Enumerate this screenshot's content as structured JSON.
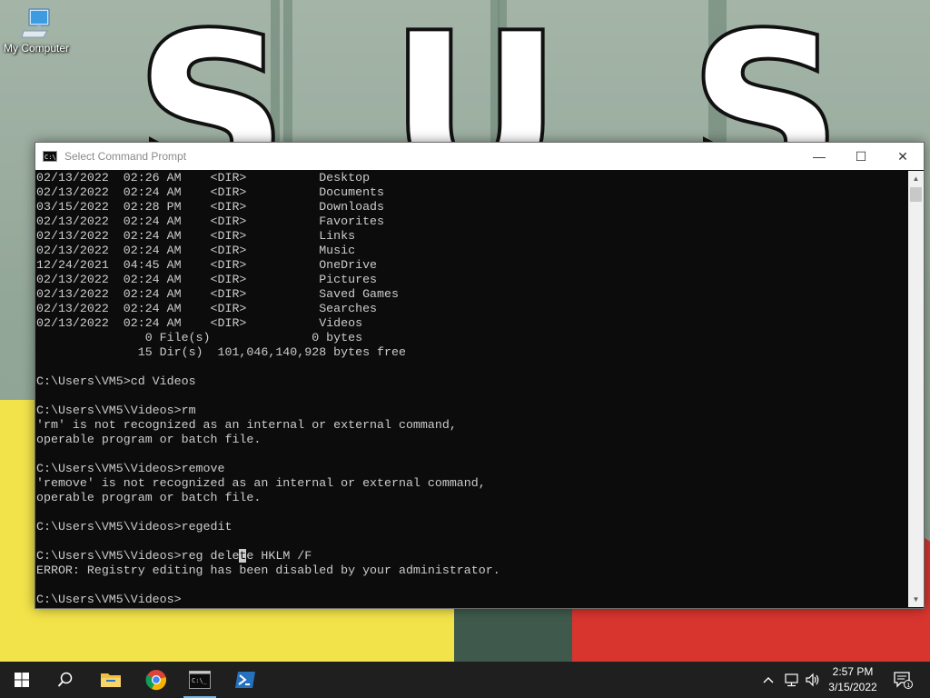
{
  "desktop": {
    "wallpaper_text": "SUS",
    "icons": [
      {
        "label": "My Computer",
        "icon": "computer-icon"
      }
    ]
  },
  "window": {
    "title": "Select Command Prompt",
    "app_icon_text": "C:\\_",
    "controls": {
      "minimize": "—",
      "maximize": "☐",
      "close": "✕"
    }
  },
  "console": {
    "lines": [
      "02/13/2022  02:26 AM    <DIR>          Desktop",
      "02/13/2022  02:24 AM    <DIR>          Documents",
      "03/15/2022  02:28 PM    <DIR>          Downloads",
      "02/13/2022  02:24 AM    <DIR>          Favorites",
      "02/13/2022  02:24 AM    <DIR>          Links",
      "02/13/2022  02:24 AM    <DIR>          Music",
      "12/24/2021  04:45 AM    <DIR>          OneDrive",
      "02/13/2022  02:24 AM    <DIR>          Pictures",
      "02/13/2022  02:24 AM    <DIR>          Saved Games",
      "02/13/2022  02:24 AM    <DIR>          Searches",
      "02/13/2022  02:24 AM    <DIR>          Videos",
      "               0 File(s)              0 bytes",
      "              15 Dir(s)  101,046,140,928 bytes free",
      "",
      "C:\\Users\\VM5>cd Videos",
      "",
      "C:\\Users\\VM5\\Videos>rm",
      "'rm' is not recognized as an internal or external command,",
      "operable program or batch file.",
      "",
      "C:\\Users\\VM5\\Videos>remove",
      "'remove' is not recognized as an internal or external command,",
      "operable program or batch file.",
      "",
      "C:\\Users\\VM5\\Videos>regedit",
      "",
      "SELECTION",
      "ERROR: Registry editing has been disabled by your administrator.",
      "",
      "C:\\Users\\VM5\\Videos>"
    ],
    "selection_line": {
      "before": "C:\\Users\\VM5\\Videos>reg dele",
      "selected": "t",
      "after": "e HKLM /F"
    }
  },
  "taskbar": {
    "apps": [
      {
        "name": "start-button",
        "icon": "windows-icon"
      },
      {
        "name": "search-button",
        "icon": "search-icon"
      },
      {
        "name": "file-explorer",
        "icon": "folder-icon"
      },
      {
        "name": "chrome",
        "icon": "chrome-icon"
      },
      {
        "name": "command-prompt",
        "icon": "cmd-icon",
        "active": true
      },
      {
        "name": "powershell",
        "icon": "powershell-icon"
      }
    ],
    "clock": {
      "time": "2:57 PM",
      "date": "3/15/2022"
    },
    "notification_count": "1"
  }
}
